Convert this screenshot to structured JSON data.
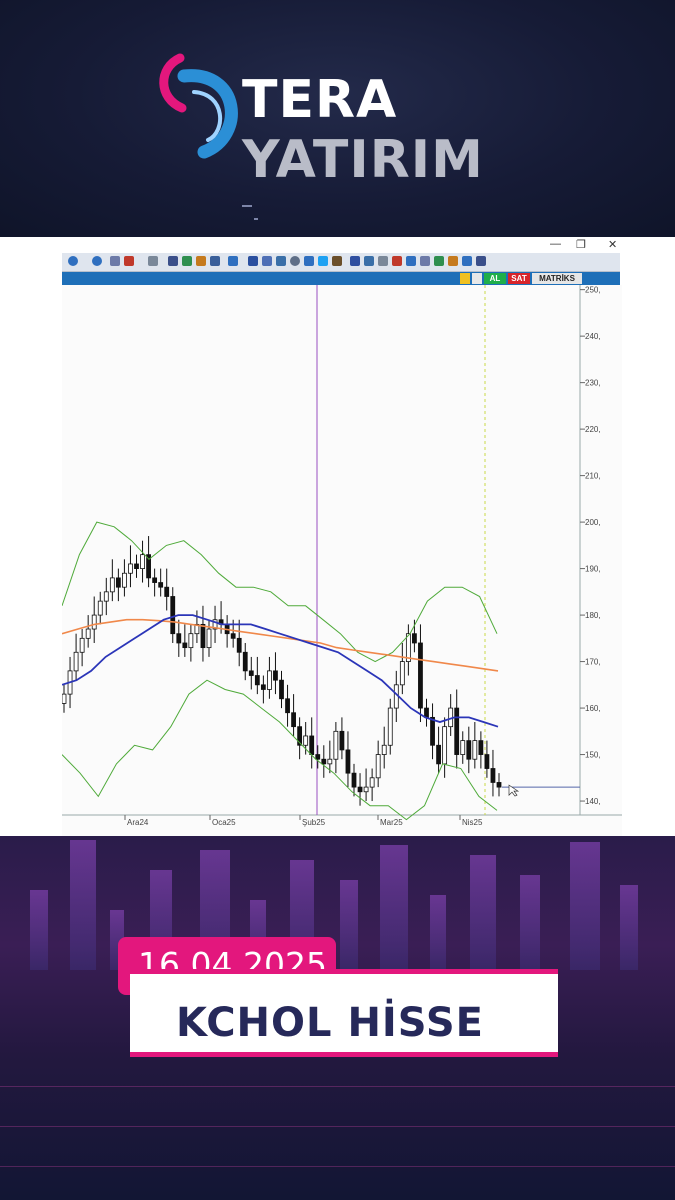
{
  "brand": {
    "name_bold": "TERA",
    "name_light": "YATIRIM",
    "colors": {
      "pink": "#e3177d",
      "blue": "#2b8fd6",
      "navy": "#26295a"
    }
  },
  "window": {
    "controls": [
      "—",
      "❐",
      "✕"
    ],
    "chart_toolbar": {
      "buy_label": "AL",
      "sell_label": "SAT",
      "brand_label": "MATRİKS"
    }
  },
  "post": {
    "date": "16.04.2025",
    "title": "KCHOL HİSSE"
  },
  "chart_data": {
    "type": "candlestick",
    "y_ticks": [
      "250,",
      "240,",
      "230,",
      "220,",
      "210,",
      "200,",
      "190,",
      "180,",
      "170,",
      "160,",
      "150,",
      "140,"
    ],
    "ylim": [
      137,
      251
    ],
    "x_labels": [
      "Ara24",
      "Oca25",
      "Şub25",
      "Mar25",
      "Nis25"
    ],
    "series": [
      {
        "kind": "candles",
        "color_up": "#ffffff",
        "color_down": "#111111",
        "close": [
          163,
          168,
          172,
          175,
          177,
          180,
          183,
          185,
          188,
          186,
          189,
          191,
          190,
          193,
          188,
          187,
          186,
          184,
          176,
          174,
          173,
          176,
          178,
          173,
          177,
          179,
          178,
          176,
          175,
          172,
          168,
          167,
          165,
          164,
          168,
          166,
          162,
          159,
          156,
          152,
          154,
          150,
          149,
          148,
          149,
          155,
          151,
          146,
          143,
          142,
          143,
          145,
          150,
          152,
          160,
          165,
          170,
          176,
          174,
          160,
          158,
          152,
          148,
          156,
          160,
          150,
          153,
          149,
          153,
          150,
          147,
          144,
          143
        ]
      },
      {
        "kind": "line",
        "color": "#2b35b8",
        "values": [
          165,
          166,
          168,
          171,
          173,
          175,
          177,
          179,
          180,
          180,
          179,
          178,
          178,
          178,
          177,
          176,
          175,
          174,
          173,
          172,
          170,
          168,
          166,
          163,
          160,
          158,
          157,
          158,
          158,
          157,
          156
        ]
      },
      {
        "kind": "line",
        "color": "#f0884a",
        "values": [
          176,
          177,
          178,
          178.5,
          179,
          179,
          178.8,
          178.5,
          178,
          177.5,
          177,
          176.5,
          176,
          175.5,
          175,
          174.5,
          174,
          173,
          172.5,
          172,
          171.5,
          171,
          170.5,
          170,
          169.5,
          169,
          168.5,
          168
        ]
      },
      {
        "kind": "band",
        "color": "#4faa3a",
        "upper": [
          182,
          193,
          200,
          199,
          196,
          192,
          195,
          196,
          193,
          189,
          186,
          186,
          185,
          182,
          182,
          179,
          176,
          172,
          170,
          172,
          176,
          183,
          186,
          186,
          184,
          176
        ],
        "lower": [
          150,
          146,
          141,
          148,
          152,
          151,
          156,
          163,
          166,
          164,
          163,
          160,
          157,
          153,
          149,
          146,
          142,
          139,
          139,
          136,
          139,
          148,
          147,
          141,
          138
        ]
      }
    ],
    "price_line": 143
  }
}
